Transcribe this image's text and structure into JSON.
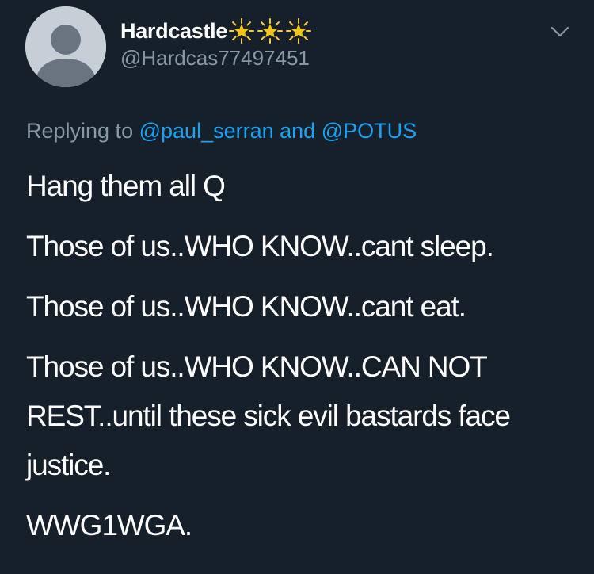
{
  "user": {
    "display_name": "Hardcastle",
    "handle": "@Hardcas77497451",
    "badges": [
      "sparkle-star-icon",
      "sparkle-star-icon",
      "sparkle-star-icon"
    ],
    "avatar": "default-avatar"
  },
  "reply": {
    "prefix": "Replying to",
    "mention_1": "@paul_serran",
    "conjunction": "and",
    "mention_2": "@POTUS"
  },
  "tweet": {
    "lines": [
      "Hang them all Q",
      "Those of us..WHO KNOW..cant sleep.",
      "Those of us..WHO KNOW..cant eat.",
      "Those of us..WHO KNOW..CAN NOT REST..until these sick evil bastards face justice.",
      "WWG1WGA."
    ]
  },
  "icons": {
    "menu": "chevron-down-icon"
  },
  "colors": {
    "background": "#15202b",
    "secondary_text": "#8899a6",
    "link": "#1da1f2",
    "badge": "#f5c518"
  }
}
